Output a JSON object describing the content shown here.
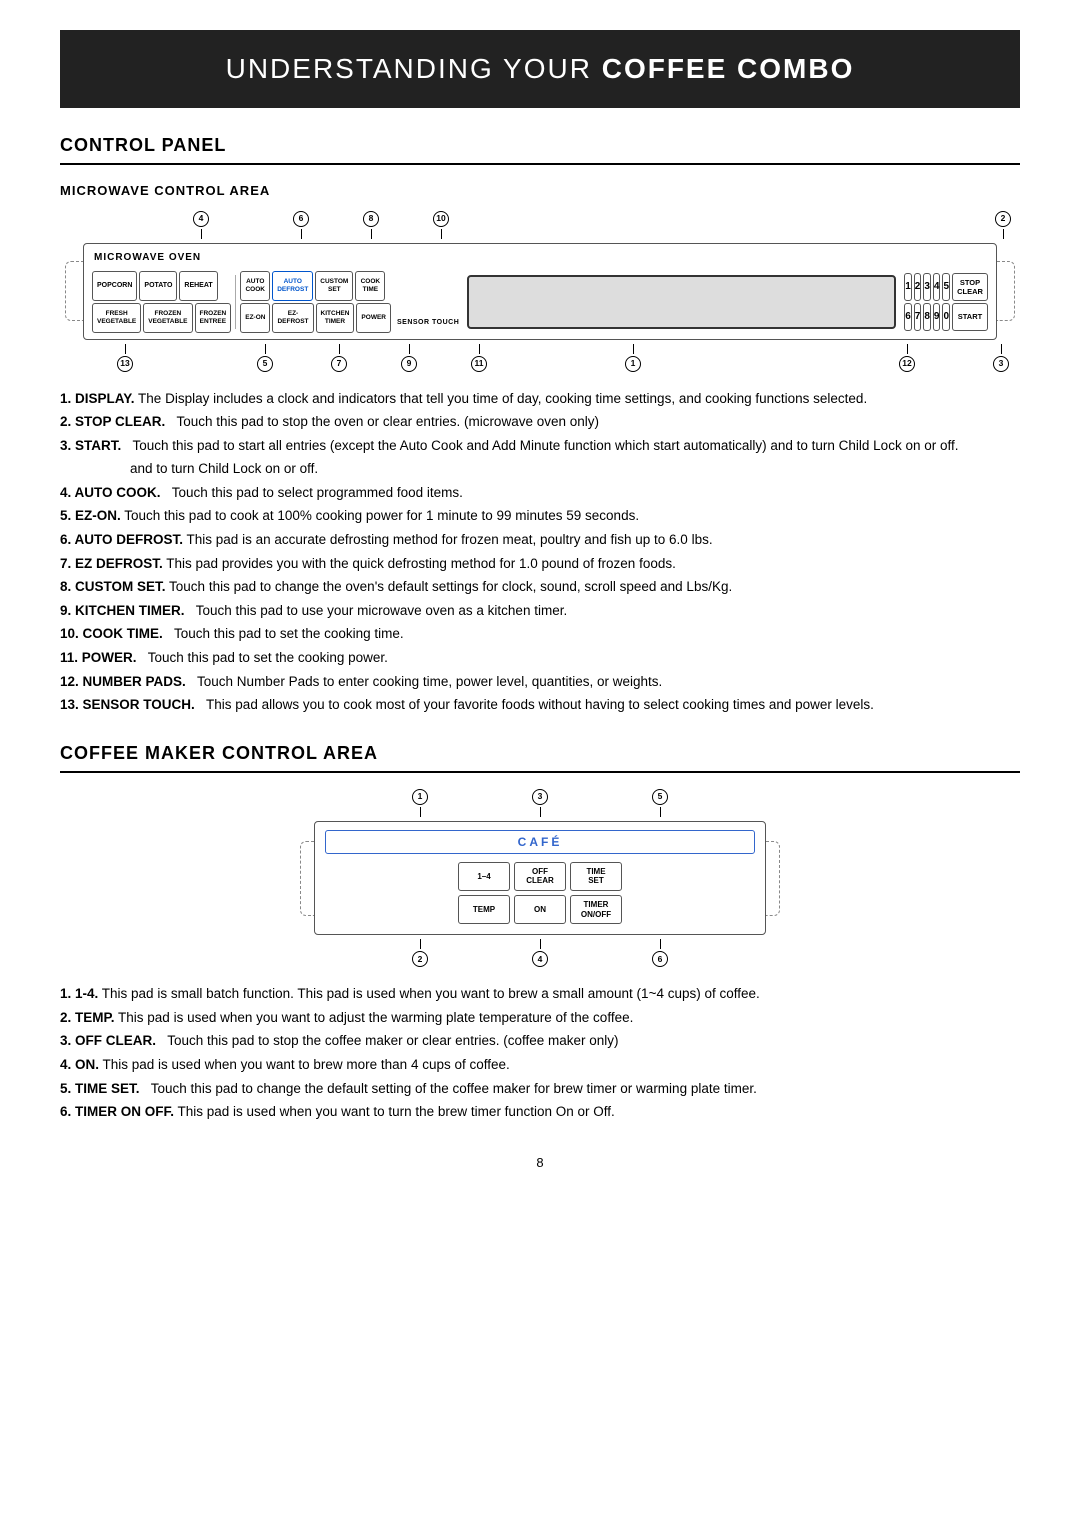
{
  "header": {
    "light": "Understanding Your ",
    "bold": "Coffee Combo"
  },
  "section1": {
    "title": "Control Panel",
    "sub1": "Microwave Control Area",
    "microwave_panel_title": "MICROWAVE OVEN",
    "buttons_row1": [
      {
        "label": "POPCORN",
        "group": "auto"
      },
      {
        "label": "POTATO",
        "group": "auto"
      },
      {
        "label": "REHEAT",
        "group": "auto"
      },
      {
        "label": "AUTO\nCOOK",
        "group": "auto"
      },
      {
        "label": "AUTO\nDEFROST",
        "group": "auto",
        "style": "blue"
      },
      {
        "label": "CUSTOM\nSET",
        "group": "auto"
      },
      {
        "label": "COOK\nTIME",
        "group": "auto"
      }
    ],
    "buttons_row2": [
      {
        "label": "FRESH\nVEGETABLE"
      },
      {
        "label": "FROZEN\nVEGETABLE"
      },
      {
        "label": "FROZEN\nENTREE"
      },
      {
        "label": "EZ-ON"
      },
      {
        "label": "EZ-\nDEFROST"
      },
      {
        "label": "KITCHEN\nTIMER"
      },
      {
        "label": "POWER"
      }
    ],
    "numpad": [
      "1",
      "2",
      "3",
      "4",
      "5",
      "6",
      "7",
      "8",
      "9",
      "0"
    ],
    "stop_clear": "Stop\nCLEAR",
    "start": "START",
    "sensor_touch": "SENSOR TOUCH",
    "callouts_top": [
      "4",
      "6",
      "8",
      "10",
      "2"
    ],
    "callouts_bottom": [
      "13",
      "5",
      "7",
      "9",
      "11",
      "1",
      "12",
      "3"
    ],
    "descriptions": [
      {
        "num": "1",
        "bold": "DISPLAY.",
        "text": " The Display includes a clock and indicators that tell you time of day, cooking time settings, and cooking functions selected."
      },
      {
        "num": "2",
        "bold": "STOP CLEAR.",
        "text": "   Touch this pad to stop the oven or clear entries. (microwave oven only)"
      },
      {
        "num": "3",
        "bold": "START.",
        "text": "   Touch this pad to start all entries (except the Auto Cook and Add Minute function which start automatically) and to turn Child Lock on or off.",
        "indent": true
      },
      {
        "num": "4",
        "bold": "AUTO COOK.",
        "text": "   Touch this pad to select programmed food items."
      },
      {
        "num": "5",
        "bold": "EZ-ON.",
        "text": " Touch this pad to cook at 100% cooking power for 1 minute to 99 minutes 59 seconds."
      },
      {
        "num": "6",
        "bold": "AUTO DEFROST.",
        "text": " This pad is an accurate defrosting method for frozen meat, poultry and fish up to 6.0 lbs."
      },
      {
        "num": "7",
        "bold": "EZ  DEFROST.",
        "text": " This pad provides you with the quick defrosting method for 1.0 pound of frozen foods."
      },
      {
        "num": "8",
        "bold": "CUSTOM SET.",
        "text": " Touch this pad to change the oven's default settings for clock, sound, scroll speed and Lbs/Kg."
      },
      {
        "num": "9",
        "bold": "KITCHEN TIMER.",
        "text": "   Touch this pad to use your microwave oven as a kitchen timer."
      },
      {
        "num": "10",
        "bold": "COOK TIME.",
        "text": "   Touch this pad to set the cooking time."
      },
      {
        "num": "11",
        "bold": "POWER.",
        "text": "   Touch this pad to set the cooking power."
      },
      {
        "num": "12",
        "bold": "NUMBER PADS.",
        "text": "   Touch Number Pads to enter cooking time, power level, quantities, or weights."
      },
      {
        "num": "13",
        "bold": "SENSOR TOUCH.",
        "text": "   This pad allows you to cook most of your favorite foods without having to select cooking times and power levels.",
        "indent": true
      }
    ]
  },
  "section2": {
    "title": "Coffee Maker Control Area",
    "panel_title": "CAFÉ",
    "buttons_row1": [
      {
        "label": "1–4"
      },
      {
        "label": "OFF\nCLEAR"
      },
      {
        "label": "TIME\nSET"
      }
    ],
    "buttons_row2": [
      {
        "label": "TEMP"
      },
      {
        "label": "ON"
      },
      {
        "label": "TIMER\nON/OFF"
      }
    ],
    "callouts_top": [
      "1",
      "3",
      "5"
    ],
    "callouts_bottom": [
      "2",
      "4",
      "6"
    ],
    "descriptions": [
      {
        "num": "1",
        "bold": "1-4.",
        "text": " This pad is small batch function. This pad is used when you want to brew a small amount (1~4 cups) of coffee."
      },
      {
        "num": "2",
        "bold": "TEMP.",
        "text": " This pad is used when you want to adjust the warming plate temperature of the coffee."
      },
      {
        "num": "3",
        "bold": "OFF CLEAR.",
        "text": "   Touch this pad to stop the coffee maker or clear entries. (coffee maker only)"
      },
      {
        "num": "4",
        "bold": "ON.",
        "text": " This pad is used when you want to brew more than 4 cups of coffee."
      },
      {
        "num": "5",
        "bold": "TIME SET.",
        "text": "   Touch this pad to change the default setting of the coffee maker for brew timer or warming plate timer."
      },
      {
        "num": "6",
        "bold": "TIMER ON OFF.",
        "text": " This pad is used when you want to turn the brew timer function On or Off."
      }
    ]
  },
  "page_number": "8"
}
